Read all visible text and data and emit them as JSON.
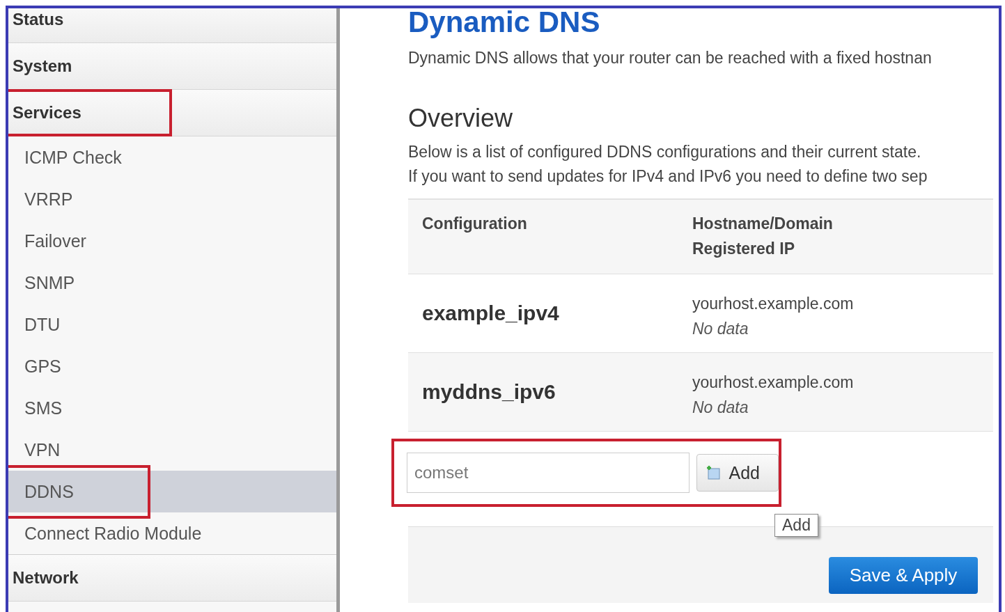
{
  "sidebar": {
    "items": [
      {
        "label": "Status",
        "kind": "section",
        "selected": false,
        "highlighted": false
      },
      {
        "label": "System",
        "kind": "section",
        "selected": false,
        "highlighted": false
      },
      {
        "label": "Services",
        "kind": "section",
        "selected": false,
        "highlighted": true
      },
      {
        "label": "ICMP Check",
        "kind": "sub",
        "selected": false,
        "highlighted": false
      },
      {
        "label": "VRRP",
        "kind": "sub",
        "selected": false,
        "highlighted": false
      },
      {
        "label": "Failover",
        "kind": "sub",
        "selected": false,
        "highlighted": false
      },
      {
        "label": "SNMP",
        "kind": "sub",
        "selected": false,
        "highlighted": false
      },
      {
        "label": "DTU",
        "kind": "sub",
        "selected": false,
        "highlighted": false
      },
      {
        "label": "GPS",
        "kind": "sub",
        "selected": false,
        "highlighted": false
      },
      {
        "label": "SMS",
        "kind": "sub",
        "selected": false,
        "highlighted": false
      },
      {
        "label": "VPN",
        "kind": "sub",
        "selected": false,
        "highlighted": false
      },
      {
        "label": "DDNS",
        "kind": "sub",
        "selected": true,
        "highlighted": true
      },
      {
        "label": "Connect Radio Module",
        "kind": "sub",
        "selected": false,
        "highlighted": false
      },
      {
        "label": "Network",
        "kind": "section",
        "selected": false,
        "highlighted": false
      }
    ]
  },
  "page": {
    "title": "Dynamic DNS",
    "description": "Dynamic DNS allows that your router can be reached with a fixed hostnan"
  },
  "overview": {
    "title": "Overview",
    "description_lines": [
      "Below is a list of configured DDNS configurations and their current state.",
      "If you want to send updates for IPv4 and IPv6 you need to define two sep"
    ]
  },
  "table": {
    "columns": [
      {
        "lines": [
          "Configuration"
        ]
      },
      {
        "lines": [
          "Hostname/Domain",
          "Registered IP"
        ]
      }
    ],
    "rows": [
      {
        "name": "example_ipv4",
        "hostname": "yourhost.example.com",
        "registered_ip": "No data"
      },
      {
        "name": "myddns_ipv6",
        "hostname": "yourhost.example.com",
        "registered_ip": "No data"
      }
    ]
  },
  "add_form": {
    "value": "comset",
    "button": "Add",
    "tooltip": "Add",
    "highlighted": true
  },
  "footer": {
    "button": "Save & Apply"
  }
}
